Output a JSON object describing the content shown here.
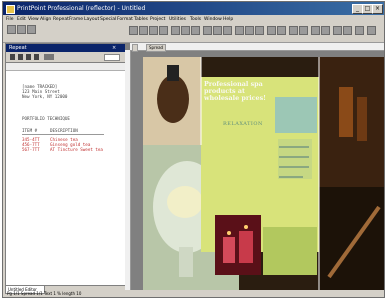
{
  "window": {
    "title": "PrintPoint Professional (reflector) - Untitled"
  },
  "menubar": [
    "File",
    "Edit",
    "View",
    "Align",
    "Repeat",
    "Frame",
    "Layout",
    "Special",
    "Format",
    "Tables",
    "Project",
    "Utilities",
    "Tools",
    "Window",
    "Help"
  ],
  "left_pane": {
    "title": "Repeat",
    "address_lines": [
      "[name TRACKED]",
      "123 Main Street",
      "New York, NY 12000"
    ],
    "section_title": "PORTFOLIO TECHNIQUE",
    "col_item": "ITEM #",
    "col_desc": "DESCRIPTION",
    "rows": [
      {
        "item": "345-4TT",
        "desc": "Chinese tea"
      },
      {
        "item": "456-7TT",
        "desc": "Ginseng gold tea"
      },
      {
        "item": "567-7TT",
        "desc": "AT Tincture Sweet tea"
      }
    ],
    "bottom_tab": "Untitled Editor"
  },
  "statusbar": {
    "left": "Pg 1/1  Spread 1/1  Text 1 % length 10"
  },
  "document": {
    "tab": "Spread",
    "headline": "Professional spa products at wholesale prices!",
    "logo_text": "RELAXATION"
  }
}
